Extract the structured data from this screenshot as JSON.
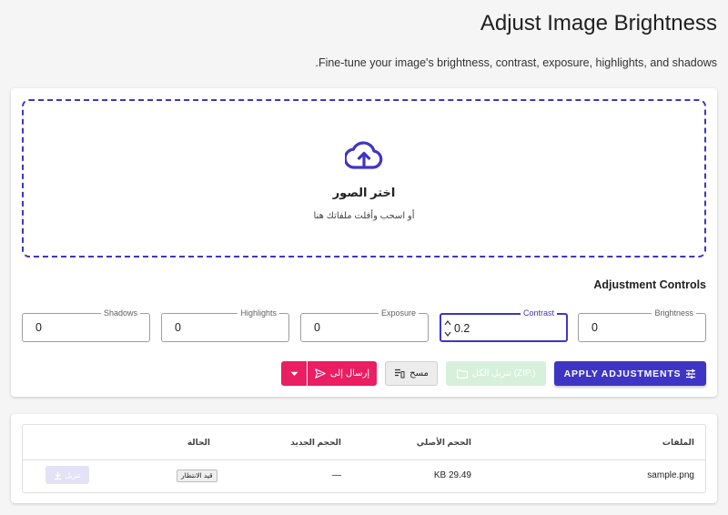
{
  "header": {
    "title": "Adjust Image Brightness",
    "subtitle": ".Fine-tune your image's brightness, contrast, exposure, highlights, and shadows"
  },
  "dropzone": {
    "icon": "cloud-upload-icon",
    "title": "اختر الصور",
    "subtitle": "أو اسحب وأفلت ملفاتك هنا"
  },
  "controls": {
    "title": "Adjustment Controls",
    "fields": {
      "shadows": {
        "label": "Shadows",
        "value": "0"
      },
      "highlights": {
        "label": "Highlights",
        "value": "0"
      },
      "exposure": {
        "label": "Exposure",
        "value": "0"
      },
      "contrast": {
        "label": "Contrast",
        "value": "0.2"
      },
      "brightness": {
        "label": "Brightness",
        "value": "0"
      }
    }
  },
  "actions": {
    "apply": "APPLY ADJUSTMENTS",
    "zip": "تنزيل الكل (ZIP.)",
    "clear": "مسح",
    "send": "إرسال إلى"
  },
  "table": {
    "headers": {
      "files": "الملفات",
      "original_size": "الحجم الأصلي",
      "new_size": "الحجم الجديد",
      "status": "الحالة"
    },
    "rows": [
      {
        "file": "sample.png",
        "original_size": "KB 29.49",
        "new_size": "—",
        "status": "قيد الانتظار",
        "action": "تنزيل"
      }
    ]
  },
  "colors": {
    "accent": "#3f35c4",
    "send": "#e91e63",
    "zip_disabled": "#d7f0dc"
  }
}
